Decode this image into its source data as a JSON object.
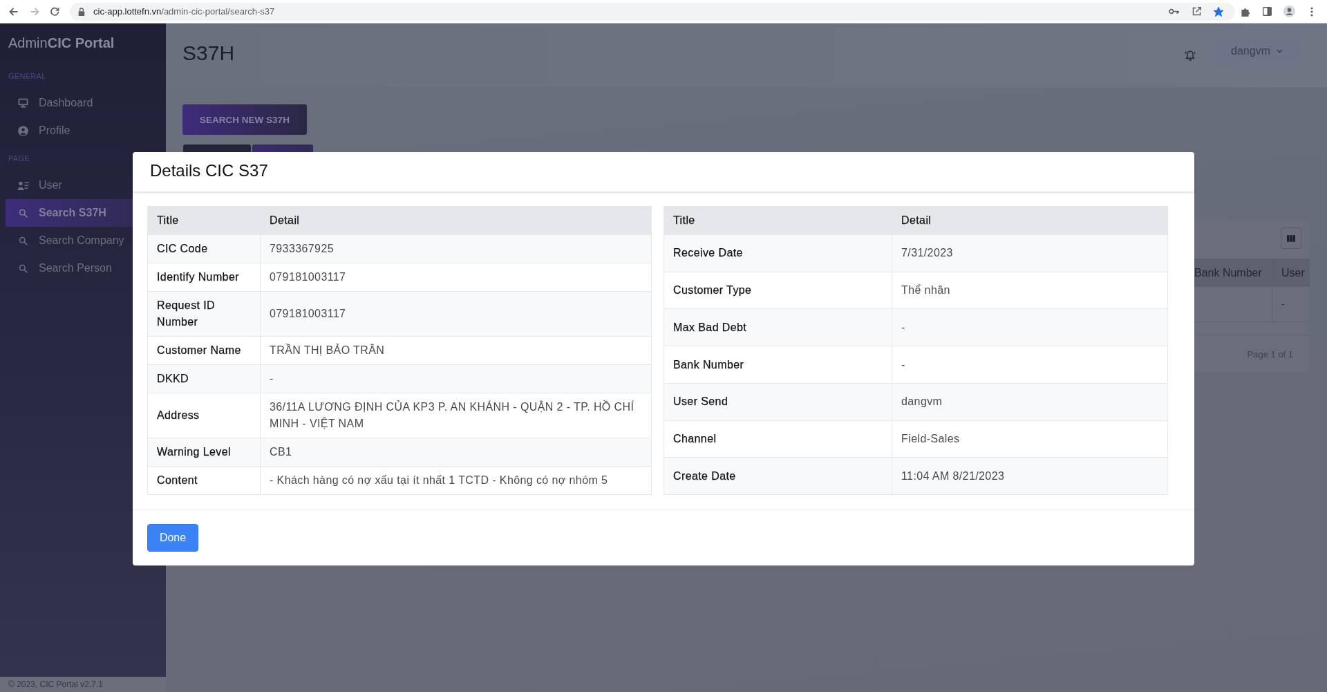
{
  "browser": {
    "host": "cic-app.lottefn.vn",
    "path": "/admin-cic-portal/search-s37",
    "bookmarked": true
  },
  "sidebar": {
    "brand": "Admin**CIC Portal**",
    "sections": [
      {
        "heading": "GENERAL",
        "items": [
          {
            "label": "Dashboard",
            "selected": false
          },
          {
            "label": "Profile",
            "selected": false
          }
        ]
      },
      {
        "heading": "PAGE",
        "items": [
          {
            "label": "User",
            "selected": false
          },
          {
            "label": "Search S37H",
            "selected": true
          },
          {
            "label": "Search Company",
            "selected": false
          },
          {
            "label": "Search Person",
            "selected": false
          }
        ]
      }
    ],
    "footer": "© 2023, CIC Portal v2.7.1"
  },
  "header": {
    "title": "S37H",
    "user_menu": "dangvm"
  },
  "actions": [
    {
      "label": "SEARCH NEW S37H"
    }
  ],
  "tab_strip": [
    {
      "selected": false
    },
    {
      "selected": true
    }
  ],
  "results_table": {
    "columns": [
      {
        "label": "Bank Number"
      },
      {
        "label": "User",
        "cells": [
          "-"
        ]
      }
    ],
    "pager": "Page 1 of 1"
  },
  "modal": {
    "title": "Details CIC S37",
    "tables": [
      {
        "columns": [
          "Title",
          "Detail"
        ],
        "rows": [
          {
            "title": "CIC Code",
            "detail": "7933367925"
          },
          {
            "title": "Identify Number",
            "detail": "079181003117"
          },
          {
            "title": "Request ID Number",
            "detail": "079181003117"
          },
          {
            "title": "Customer Name",
            "detail": "TRẦN THỊ BẢO TRÂN"
          },
          {
            "title": "DKKD",
            "detail": "-"
          },
          {
            "title": "Address",
            "detail": "36/11A LƯƠNG ĐỊNH CỦA KP3 P. AN KHÁNH - QUẬN 2 - TP. HỒ CHÍ MINH - VIỆT NAM"
          },
          {
            "title": "Warning Level",
            "detail": "CB1"
          },
          {
            "title": "Content",
            "detail": "- Khách hàng có nợ xấu tại ít nhất 1 TCTD - Không có nợ nhóm 5"
          }
        ]
      },
      {
        "columns": [
          "Title",
          "Detail"
        ],
        "rows": [
          {
            "title": "Receive Date",
            "detail": "7/31/2023"
          },
          {
            "title": "Customer Type",
            "detail": "Thể nhân"
          },
          {
            "title": "Max Bad Debt",
            "detail": "-"
          },
          {
            "title": "Bank Number",
            "detail": "-"
          },
          {
            "title": "User Send",
            "detail": "dangvm"
          },
          {
            "title": "Channel",
            "detail": "Field-Sales"
          },
          {
            "title": "Create Date",
            "detail": "11:04 AM 8/21/2023"
          }
        ]
      }
    ],
    "buttons": [
      {
        "label": "Done"
      }
    ]
  }
}
